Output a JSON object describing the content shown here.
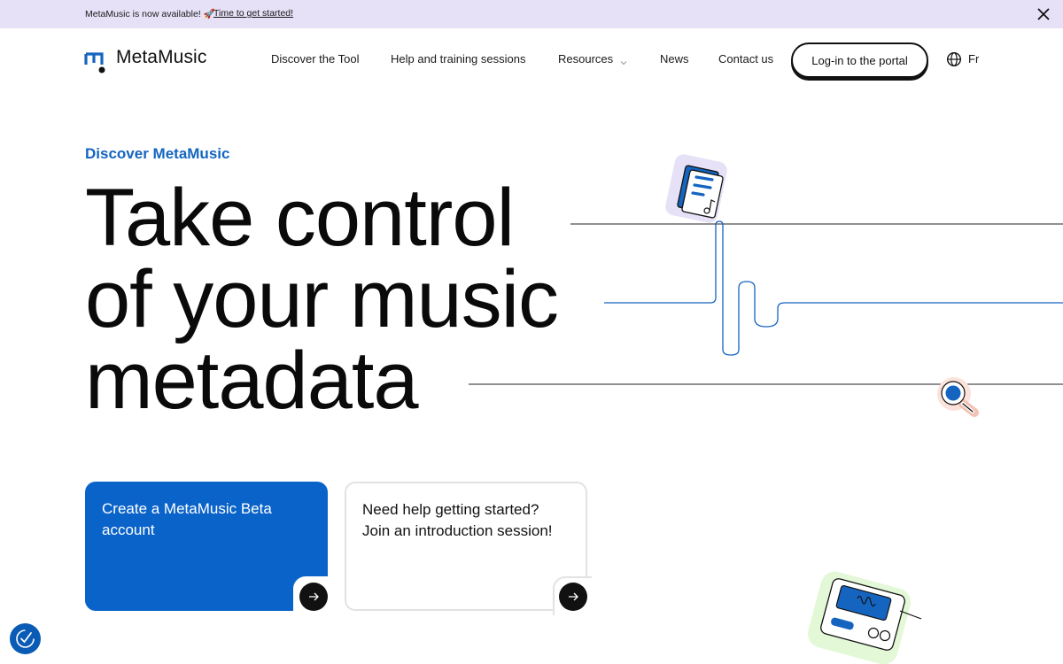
{
  "announcement": {
    "text": "MetaMusic is now available! 🚀",
    "link_text": "Time to get started!"
  },
  "header": {
    "logo_text": "MetaMusic",
    "nav": [
      {
        "label": "Discover the Tool"
      },
      {
        "label": "Help and training sessions"
      },
      {
        "label": "Resources",
        "has_dropdown": true
      },
      {
        "label": "News"
      },
      {
        "label": "Contact us"
      }
    ],
    "login_label": "Log-in to the portal",
    "language": "Fr"
  },
  "hero": {
    "eyebrow": "Discover MetaMusic",
    "headline": [
      "Take control",
      "of your music",
      "metadata"
    ]
  },
  "cards": [
    {
      "text": "Create a MetaMusic Beta account"
    },
    {
      "text": "Need help getting started? Join an introduction session!"
    }
  ],
  "colors": {
    "accent_blue": "#0a63c9",
    "eyebrow_blue": "#1565c0",
    "announcement_bg": "#e6e1f7",
    "text": "#111111"
  },
  "icons": [
    "close-icon",
    "globe-icon",
    "chevron-down-icon",
    "arrow-right-icon",
    "document-icon",
    "magnifier-icon",
    "audio-device-icon",
    "cookie-settings-icon"
  ]
}
